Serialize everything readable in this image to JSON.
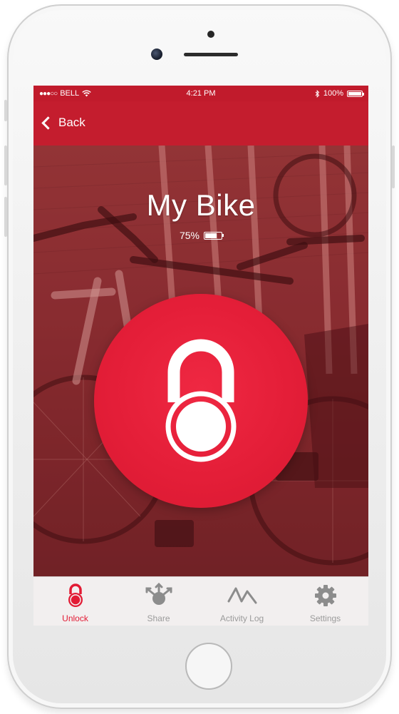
{
  "status_bar": {
    "signal": "●●●○○",
    "carrier": "BELL",
    "time": "4:21 PM",
    "battery": "100%",
    "battery_level": 1.0
  },
  "nav": {
    "back_label": "Back"
  },
  "device": {
    "name": "My Bike",
    "battery_percent": "75%",
    "battery_level": 0.75,
    "state": "locked"
  },
  "tabs": [
    {
      "label": "Unlock",
      "icon": "lock-icon",
      "active": true
    },
    {
      "label": "Share",
      "icon": "share-icon",
      "active": false
    },
    {
      "label": "Activity Log",
      "icon": "activity-icon",
      "active": false
    },
    {
      "label": "Settings",
      "icon": "gear-icon",
      "active": false
    }
  ],
  "colors": {
    "accent": "#e21b34",
    "navbar": "#c41d2e",
    "tab_inactive": "#9b9b9b",
    "tabbar_bg": "#f2efef"
  }
}
